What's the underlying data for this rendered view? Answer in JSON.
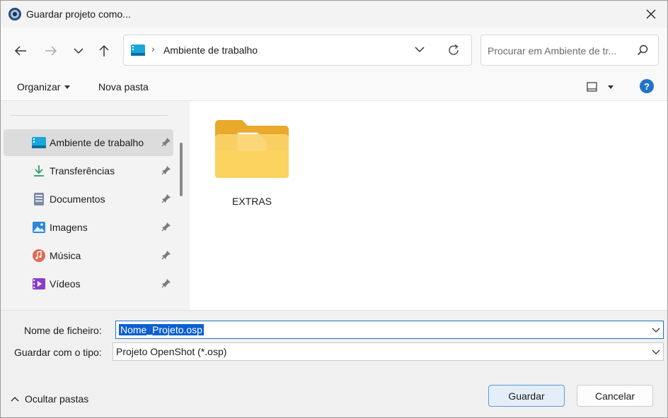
{
  "window": {
    "title": "Guardar projeto como..."
  },
  "nav": {
    "path_label": "Ambiente de trabalho",
    "search_placeholder": "Procurar em Ambiente de tr..."
  },
  "commands": {
    "organize": "Organizar",
    "new_folder": "Nova pasta",
    "help": "?"
  },
  "sidebar": {
    "items": [
      {
        "label": "Ambiente de trabalho",
        "icon": "desktop-icon",
        "selected": true,
        "pinned": true
      },
      {
        "label": "Transferências",
        "icon": "download-icon",
        "pinned": true
      },
      {
        "label": "Documentos",
        "icon": "documents-icon",
        "pinned": true
      },
      {
        "label": "Imagens",
        "icon": "pictures-icon",
        "pinned": true
      },
      {
        "label": "Música",
        "icon": "music-icon",
        "pinned": true
      },
      {
        "label": "Vídeos",
        "icon": "videos-icon",
        "pinned": true
      }
    ]
  },
  "content": {
    "items": [
      {
        "label": "EXTRAS",
        "type": "folder"
      }
    ]
  },
  "form": {
    "filename_label": "Nome de ficheiro:",
    "filename_value": "Nome_Projeto.osp",
    "type_label": "Guardar com o tipo:",
    "type_value": "Projeto OpenShot (*.osp)"
  },
  "footer": {
    "hide_folders": "Ocultar pastas",
    "save": "Guardar",
    "cancel": "Cancelar"
  },
  "colors": {
    "accent": "#1f73c8",
    "folder": "#f8c842",
    "selection": "#0b5fd1"
  }
}
